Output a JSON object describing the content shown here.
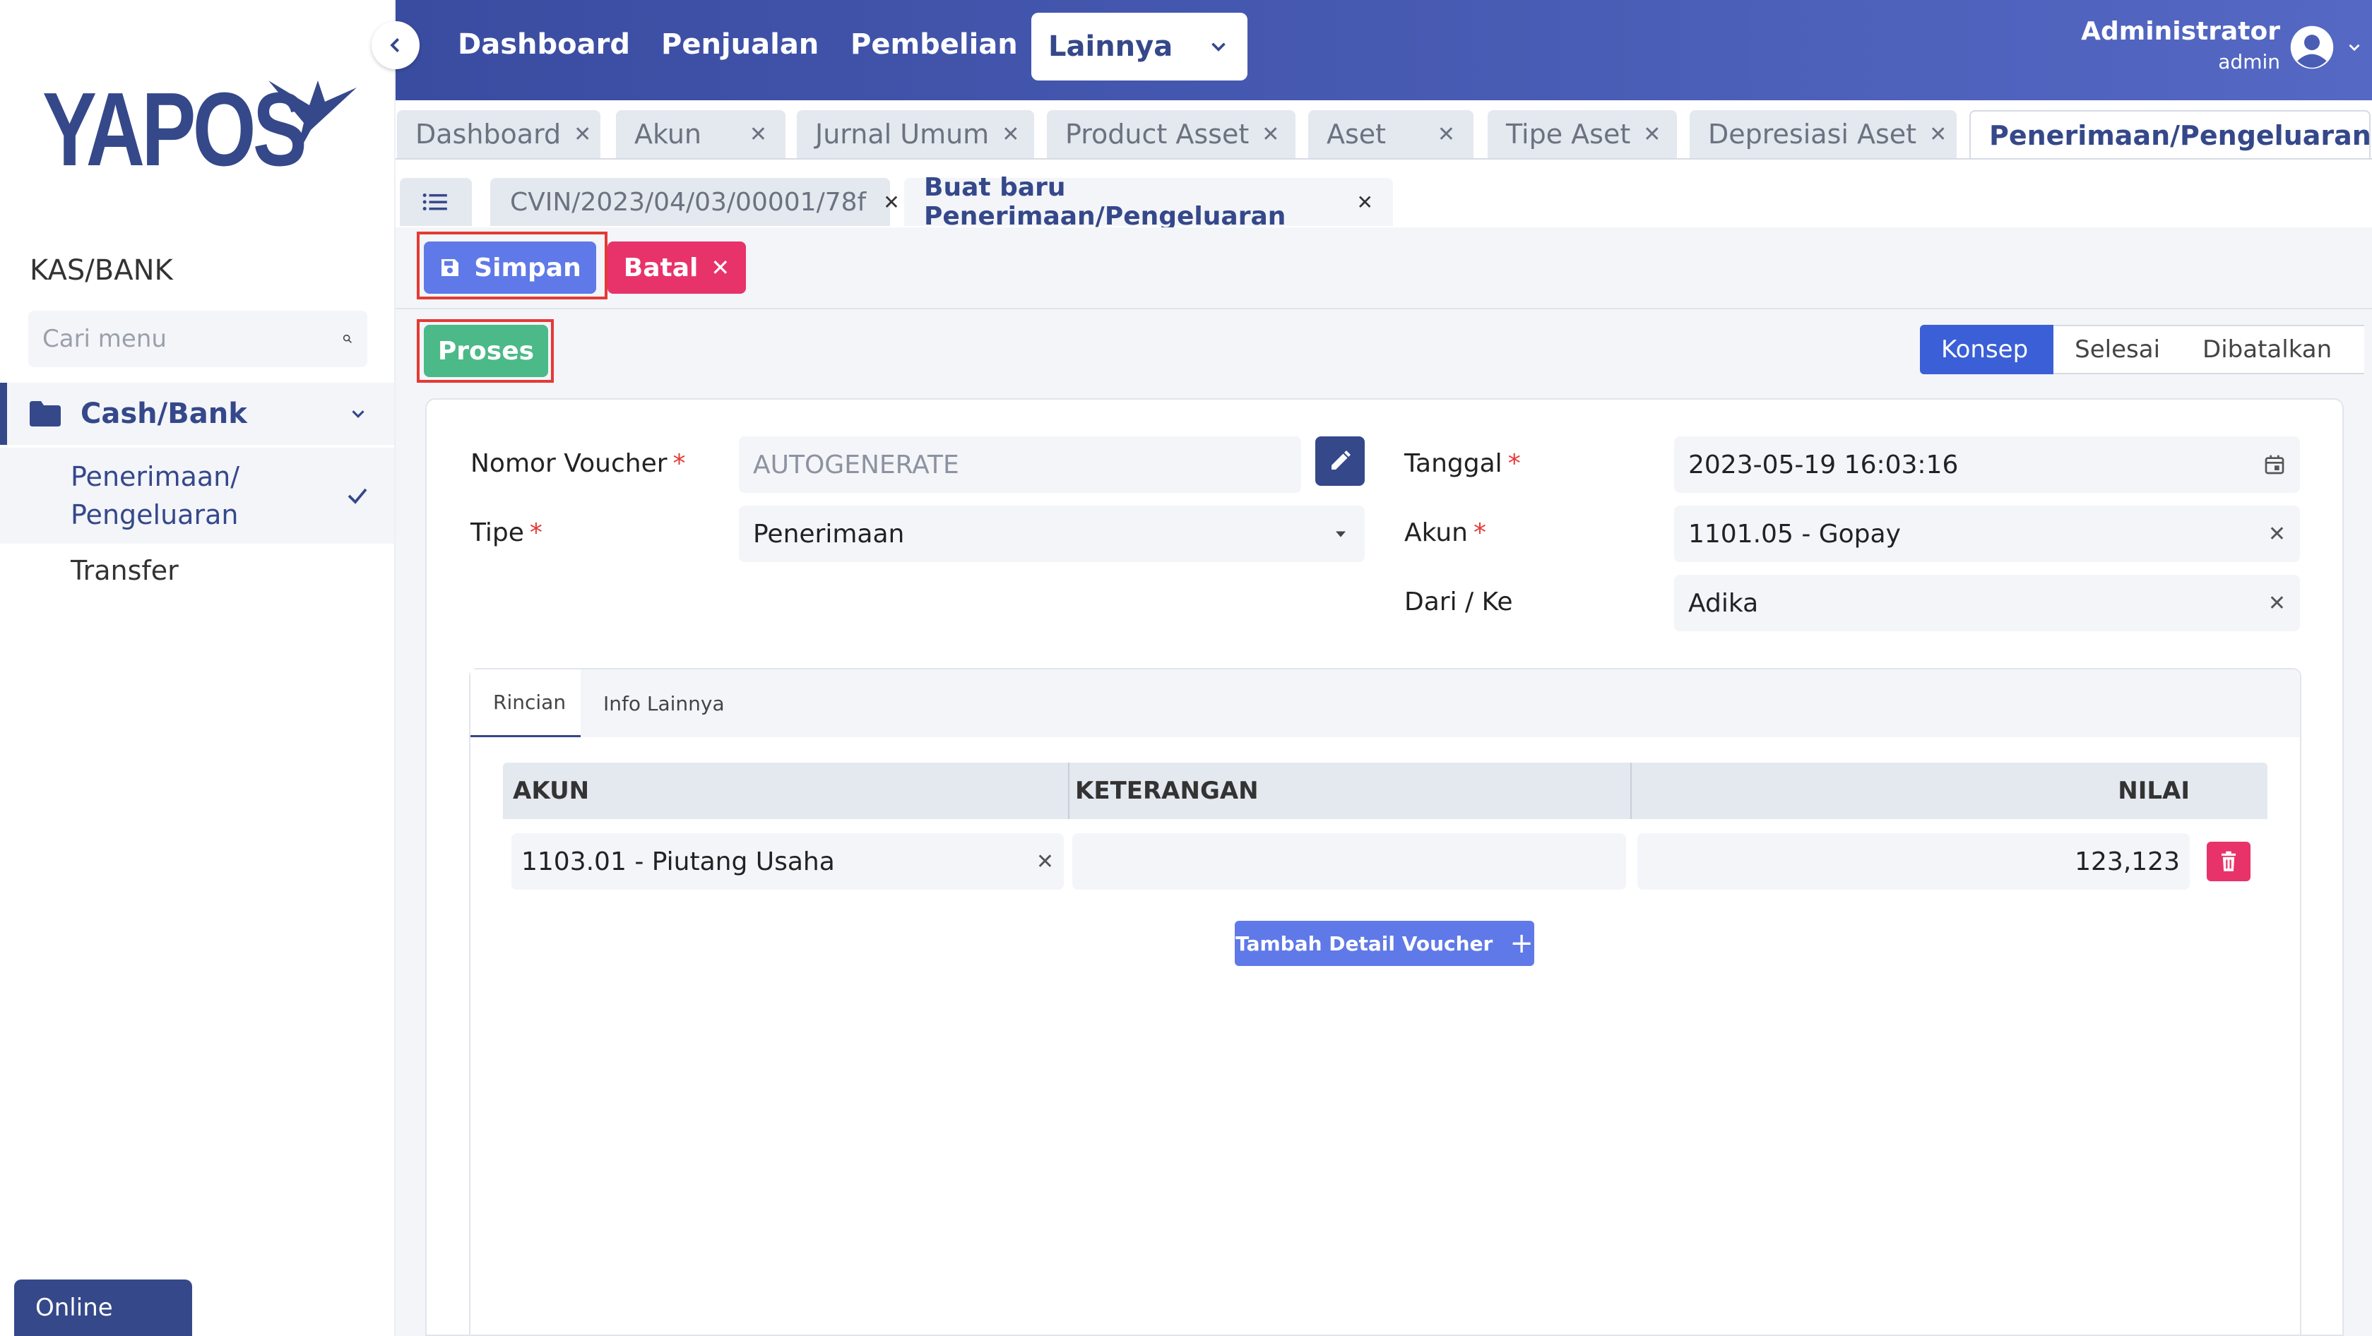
{
  "sidebar": {
    "logo_text": "YAPOS",
    "section_title": "KAS/BANK",
    "search_placeholder": "Cari menu",
    "group_label": "Cash/Bank",
    "items": [
      {
        "label": "Penerimaan/ Pengeluaran",
        "active": true
      },
      {
        "label": "Transfer",
        "active": false
      }
    ],
    "status": "Online"
  },
  "topnav": {
    "items": [
      "Dashboard",
      "Penjualan",
      "Pembelian"
    ],
    "dropdown_label": "Lainnya",
    "user_name": "Administrator",
    "user_role": "admin"
  },
  "tabs": [
    {
      "label": "Dashboard"
    },
    {
      "label": "Akun"
    },
    {
      "label": "Jurnal Umum"
    },
    {
      "label": "Product Asset"
    },
    {
      "label": "Aset"
    },
    {
      "label": "Tipe Aset"
    },
    {
      "label": "Depresiasi Aset"
    },
    {
      "label": "Penerimaan/Pengeluaran",
      "active": true
    }
  ],
  "subtabs": [
    {
      "label": "CVIN/2023/04/03/00001/78f"
    },
    {
      "label": "Buat baru Penerimaan/Pengeluaran",
      "active": true
    }
  ],
  "toolbar": {
    "save_label": "Simpan",
    "cancel_label": "Batal",
    "process_label": "Proses"
  },
  "status_steps": [
    "Konsep",
    "Selesai",
    "Dibatalkan"
  ],
  "form": {
    "voucher_label": "Nomor Voucher",
    "voucher_placeholder": "AUTOGENERATE",
    "type_label": "Tipe",
    "type_value": "Penerimaan",
    "date_label": "Tanggal",
    "date_value": "2023-05-19  16:03:16",
    "account_label": "Akun",
    "account_value": "1101.05 - Gopay",
    "party_label": "Dari / Ke",
    "party_value": "Adika",
    "required_mark": "*"
  },
  "detail": {
    "tabs": [
      "Rincian",
      "Info Lainnya"
    ],
    "columns": [
      "AKUN",
      "KETERANGAN",
      "NILAI"
    ],
    "rows": [
      {
        "account": "1103.01 - Piutang Usaha",
        "note": "",
        "amount": "123,123"
      }
    ],
    "add_label": "Tambah Detail Voucher"
  },
  "colors": {
    "primary": "#35488a",
    "save": "#5f79e8",
    "cancel": "#e8336a",
    "process": "#4cb988",
    "status_active": "#3a5fd6"
  }
}
